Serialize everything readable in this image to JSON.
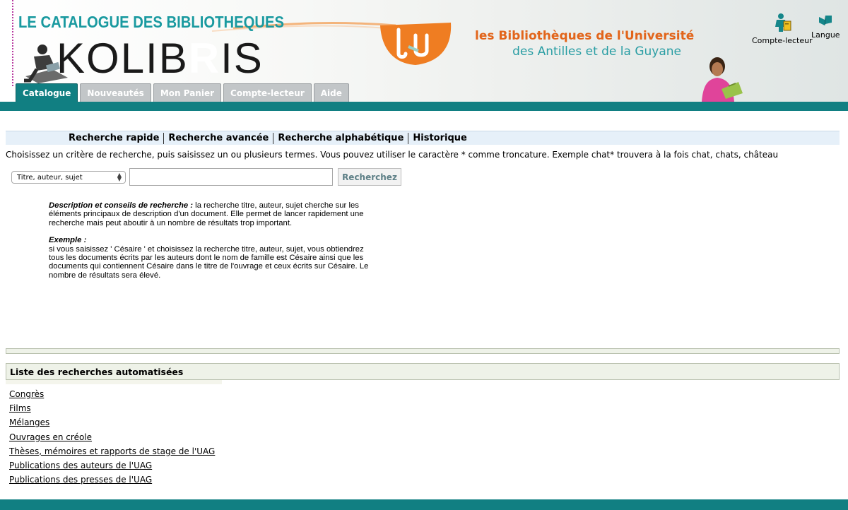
{
  "header": {
    "catalog_title": "LE CATALOGUE DES BIBLIOTHEQUES",
    "logo_text": "KOLIBRIS",
    "logo_text_left": "KOLIB",
    "logo_text_right": "IS",
    "logo_text_r": "R",
    "university_line1": "les Bibliothèques de l'Université",
    "university_line2": "des Antilles et de la Guyane",
    "compte_lecteur_link": "Compte-lecteur",
    "langue_link": "Langue",
    "colors": {
      "teal": "#117f82",
      "title_teal": "#1a9aa0",
      "orange": "#e2651b"
    }
  },
  "tabs": [
    {
      "label": "Catalogue",
      "active": true
    },
    {
      "label": "Nouveautés",
      "active": false
    },
    {
      "label": "Mon Panier",
      "active": false
    },
    {
      "label": "Compte-lecteur",
      "active": false
    },
    {
      "label": "Aide",
      "active": false
    }
  ],
  "search_menu": [
    "Recherche rapide",
    "Recherche avancée",
    "Recherche alphabétique",
    "Historique"
  ],
  "instruction": "Choisissez un critère de recherche, puis saisissez un ou plusieurs termes. Vous pouvez utiliser le caractère * comme troncature. Exemple chat* trouvera à la fois chat, chats, château",
  "search": {
    "criteria_selected": "Titre, auteur, sujet",
    "input_value": "",
    "button_label": "Recherchez"
  },
  "description": {
    "lead": "Description et conseils de recherche :",
    "text": " la recherche titre, auteur, sujet cherche sur les éléments principaux de description d'un document. Elle permet de lancer rapidement une recherche mais peut aboutir à un nombre de résultats trop important.",
    "example_title": "Exemple :",
    "example_text": "si vous saisissez ' Césaire ' et choisissez la recherche titre, auteur, sujet, vous obtiendrez tous les documents écrits par les auteurs dont le nom de famille est Césaire ainsi que les documents qui contiennent Césaire dans le titre de l'ouvrage et ceux écrits sur Césaire. Le nombre de résultats sera élevé."
  },
  "automated_searches": {
    "title": "Liste des recherches automatisées",
    "items": [
      "Congrès",
      "Films",
      "Mélanges",
      "Ouvrages en créole",
      "Thèses, mémoires et rapports de stage de l'UAG",
      "Publications des auteurs de l'UAG",
      "Publications des presses de l'UAG"
    ]
  }
}
